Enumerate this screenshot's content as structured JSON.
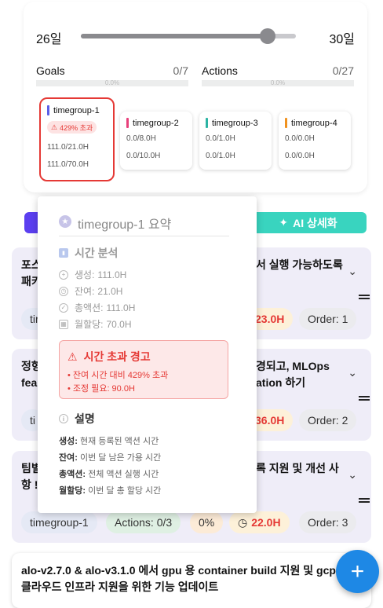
{
  "range": {
    "min_label": "26일",
    "max_label": "30일",
    "slider_value_fraction": 0.87
  },
  "stats": [
    {
      "label": "Goals",
      "count": "0/7",
      "percent": "0.0%"
    },
    {
      "label": "Actions",
      "count": "0/27",
      "percent": "0.0%"
    }
  ],
  "timegroups": [
    {
      "name": "timegroup-1",
      "color": "#5b5fe8",
      "badge": "429% 초과",
      "line1": "111.0/21.0H",
      "line2": "111.0/70.0H",
      "selected": true
    },
    {
      "name": "timegroup-2",
      "color": "#e8407b",
      "line1": "0.0/8.0H",
      "line2": "0.0/10.0H"
    },
    {
      "name": "timegroup-3",
      "color": "#2bb3a3",
      "line1": "0.0/1.0H",
      "line2": "0.0/1.0H"
    },
    {
      "name": "timegroup-4",
      "color": "#f0921f",
      "line1": "0.0/0.0H",
      "line2": "0.0/0.0H"
    }
  ],
  "ai_button": {
    "label": "AI 상세화"
  },
  "items": [
    {
      "title_left": "포스",
      "title_left2": "패키",
      "title_right": "서 실행 가능하도록",
      "chip_tg": "tir",
      "time": "23.0H",
      "order": "Order: 1"
    },
    {
      "title_left": "정형",
      "title_left2": "fea",
      "title_right": "경되고, MLOps",
      "title_right2": "ation 하기",
      "chip_tg": "ti",
      "time": "36.0H",
      "order": "Order: 2"
    },
    {
      "title_left": "팀별",
      "title_left2": "항 !",
      "title_right": "록 지원 및 개선 사",
      "chip_tg": "timegroup-1",
      "actions": "Actions: 0/3",
      "pct": "0%",
      "time": "22.0H",
      "order": "Order: 3"
    }
  ],
  "last_item": {
    "title": "alo-v2.7.0 & alo-v3.1.0 에서 gpu 용 container build 지원 및 gcp 클라우드 인프라 지원을 위한 기능 업데이트"
  },
  "fab": {
    "label": "+"
  },
  "popover": {
    "title": "timegroup-1 요약",
    "section_time": "시간 분석",
    "rows": [
      {
        "label": "생성:",
        "value": "111.0H"
      },
      {
        "label": "잔여:",
        "value": "21.0H"
      },
      {
        "label": "총액션:",
        "value": "111.0H"
      },
      {
        "label": "월할당:",
        "value": "70.0H"
      }
    ],
    "warning": {
      "title": "시간 초과 경고",
      "line1": "• 잔여 시간 대비 429% 초과",
      "line2": "• 조정 필요: 90.0H"
    },
    "section_desc": "설명",
    "desc": [
      {
        "term": "생성:",
        "text": "현재 등록된 액션 시간"
      },
      {
        "term": "잔여:",
        "text": "이번 달 남은 가용 시간"
      },
      {
        "term": "총액션:",
        "text": "전체 액션 실행 시간"
      },
      {
        "term": "월할당:",
        "text": "이번 달 총 할당 시간"
      }
    ]
  }
}
